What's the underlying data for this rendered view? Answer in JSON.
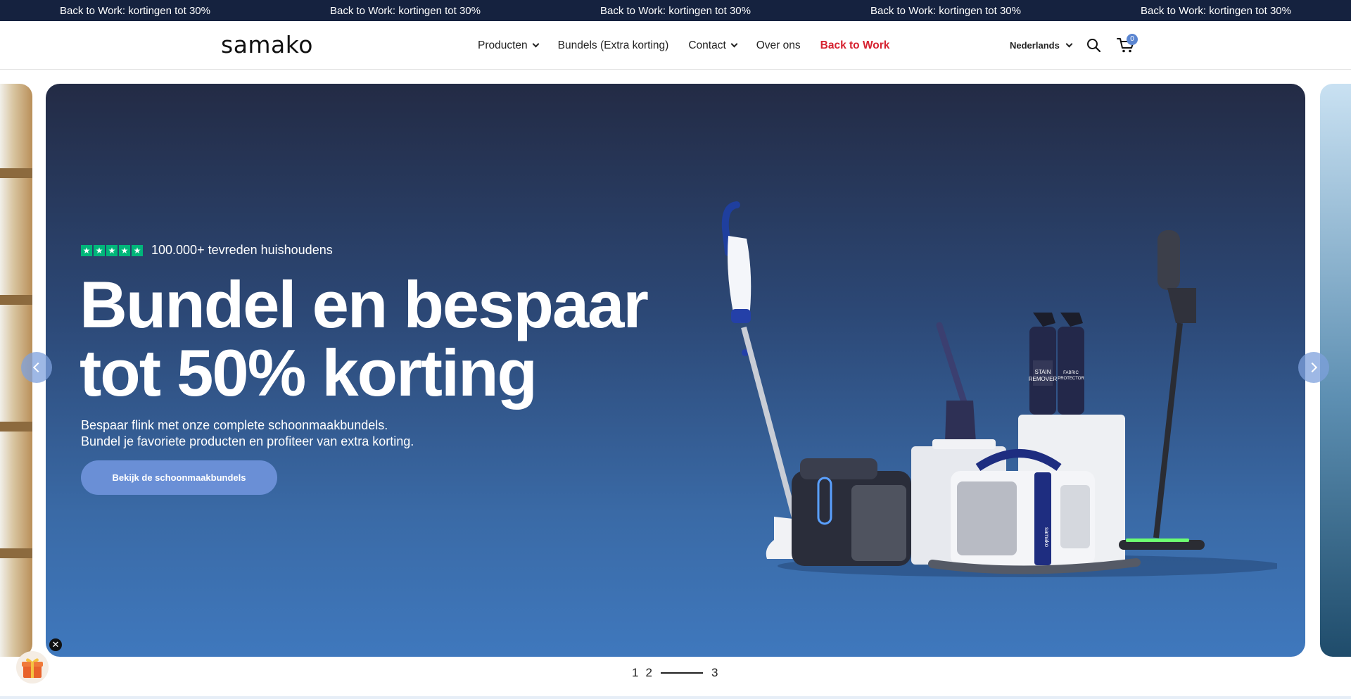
{
  "announcement": {
    "items": [
      "Back to Work: kortingen tot 30%",
      "Back to Work: kortingen tot 30%",
      "Back to Work: kortingen tot 30%",
      "Back to Work: kortingen tot 30%",
      "Back to Work: kortingen tot 30%"
    ],
    "bg_color": "#15223f"
  },
  "header": {
    "logo": "samako",
    "nav": [
      {
        "label": "Producten",
        "has_dropdown": true
      },
      {
        "label": "Bundels (Extra korting)",
        "has_dropdown": false
      },
      {
        "label": "Contact",
        "has_dropdown": true
      },
      {
        "label": "Over ons",
        "has_dropdown": false
      },
      {
        "label": "Back to Work",
        "has_dropdown": false,
        "color": "#d6212f"
      }
    ],
    "language": "Nederlands",
    "cart_count": "0",
    "icons": [
      "search-icon",
      "cart-icon",
      "chevron-down-icon"
    ]
  },
  "hero": {
    "rating_text": "100.000+ tevreden huishoudens",
    "stars": 5,
    "star_color": "#00b67a",
    "headline_line1": "Bundel en bespaar",
    "headline_line2": "tot 50% korting",
    "subtext_line1": "Bespaar flink met onze complete schoonmaakbundels.",
    "subtext_line2": "Bundel je favoriete producten en profiteer van extra korting.",
    "cta_label": "Bekijk de schoonmaakbundels",
    "cta_color": "#6a8fd6",
    "product_labels": {
      "spray_a_line1": "STAIN",
      "spray_a_line2": "REMOVER",
      "spray_b_line1": "FABRIC",
      "spray_b_line2": "PROTECTOR",
      "brand_mark": "samako"
    }
  },
  "carousel": {
    "pages": [
      "1",
      "2",
      "3"
    ],
    "active_page": 2,
    "icons": [
      "chevron-left-icon",
      "chevron-right-icon"
    ]
  },
  "widget": {
    "close_glyph": "✕",
    "icon": "gift-icon"
  }
}
